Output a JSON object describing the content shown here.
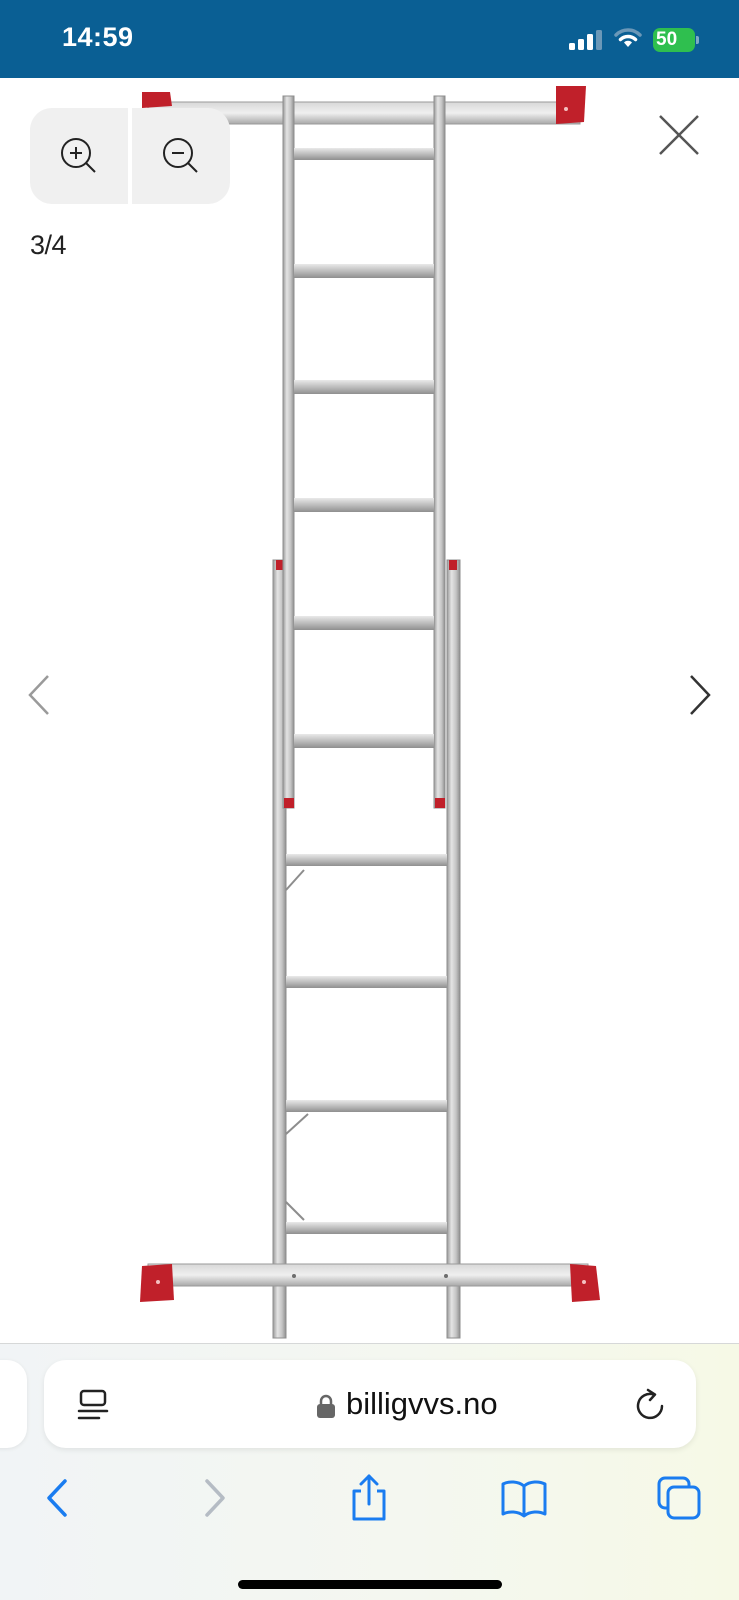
{
  "status_bar": {
    "time": "14:59",
    "battery_level": "50",
    "background_color": "#0a5f94",
    "battery_color": "#2fbf4f"
  },
  "viewer": {
    "counter": "3/4",
    "icons": {
      "zoom_in": "zoom-in-icon",
      "zoom_out": "zoom-out-icon",
      "close": "close-icon",
      "previous": "chevron-left-icon",
      "next": "chevron-right-icon"
    },
    "image_subject": "ladder",
    "accent_colors": {
      "ladder_frame": "#c8c8c8",
      "feet": "#c0202a"
    }
  },
  "browser": {
    "url": "billigvvs.no",
    "icons": {
      "reader": "reader-mode-icon",
      "lock": "lock-icon",
      "reload": "reload-icon",
      "back": "chevron-left-icon",
      "forward": "chevron-right-icon",
      "share": "share-icon",
      "bookmarks": "book-icon",
      "tabs": "tabs-icon"
    },
    "accent_color": "#1a7cf0",
    "disabled_color": "#b5bcc4"
  }
}
